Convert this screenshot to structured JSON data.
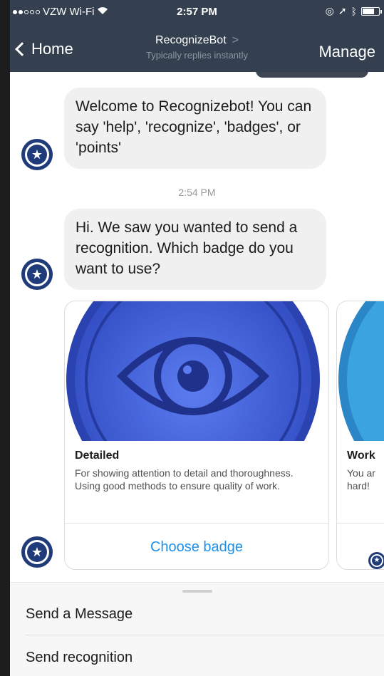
{
  "status_bar": {
    "carrier": "VZW Wi-Fi",
    "time": "2:57 PM"
  },
  "nav": {
    "back_label": "Home",
    "title": "RecognizeBot",
    "subtitle": "Typically replies instantly",
    "manage_label": "Manage"
  },
  "messages": [
    {
      "text": "Welcome to Recognizebot! You can say 'help', 'recognize', 'badges', or 'points'"
    },
    {
      "text": "Hi. We saw you wanted to send a recognition. Which badge do you want to use?"
    }
  ],
  "timestamp": "2:54 PM",
  "cards": [
    {
      "title": "Detailed",
      "description": "For showing attention to detail and thoroughness. Using good methods to ensure quality of work.",
      "button": "Choose badge",
      "image_icon": "eye-icon",
      "image_color": "#3f5fd0"
    },
    {
      "title": "Work",
      "description": "You ar hard!",
      "image_color": "#3aa3e0"
    }
  ],
  "menu": {
    "send_message": "Send a Message",
    "send_recognition": "Send recognition"
  },
  "colors": {
    "header_bg": "#34404f",
    "link_blue": "#1e90e8",
    "bubble_bg": "#f1f0f0"
  }
}
